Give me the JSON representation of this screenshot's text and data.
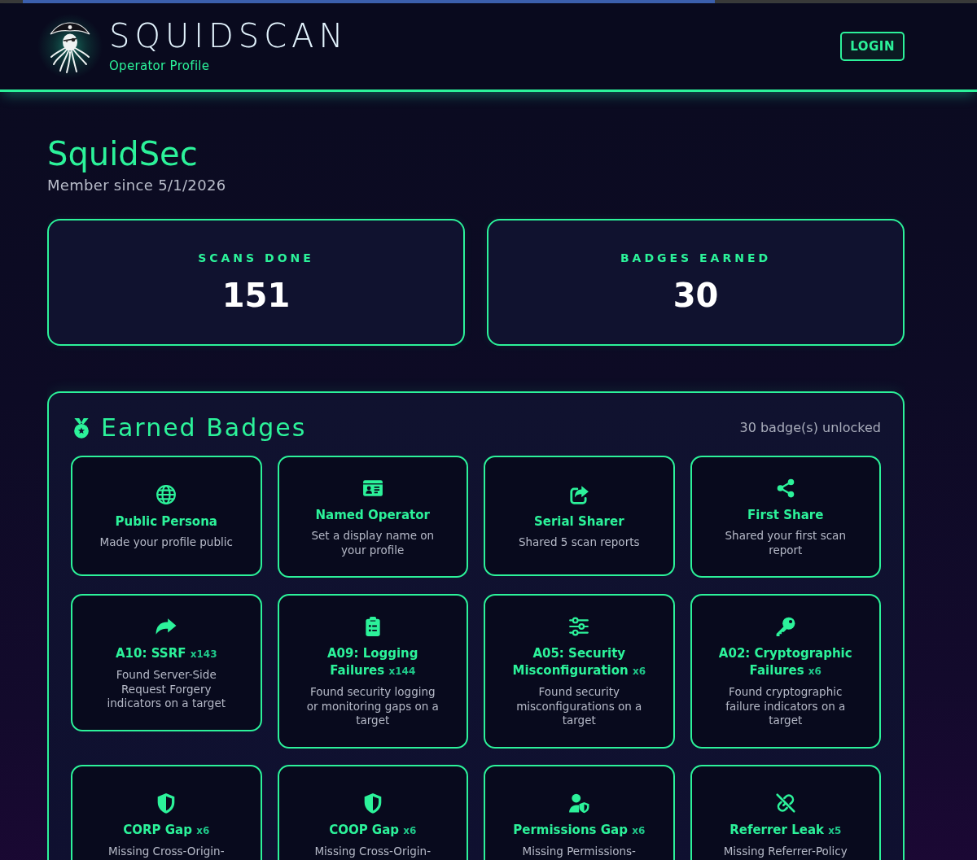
{
  "header": {
    "title": "SQUIDSCAN",
    "subtitle": "Operator Profile",
    "login_button": "LOGIN"
  },
  "profile": {
    "name": "SquidSec",
    "member_since": "Member since 5/1/2026"
  },
  "stats": [
    {
      "label": "SCANS DONE",
      "value": "151"
    },
    {
      "label": "BADGES EARNED",
      "value": "30"
    }
  ],
  "badges": {
    "title": "Earned Badges",
    "summary": "30 badge(s) unlocked",
    "items": [
      {
        "name": "Public Persona",
        "description": "Made your profile public"
      },
      {
        "name": "Named Operator",
        "description": "Set a display name on your profile"
      },
      {
        "name": "Serial Sharer",
        "description": "Shared 5 scan reports"
      },
      {
        "name": "First Share",
        "description": "Shared your first scan report"
      },
      {
        "name": "A10: SSRF",
        "count": "x143",
        "description": "Found Server-Side Request Forgery indicators on a target"
      },
      {
        "name": "A09: Logging Failures",
        "count": "x144",
        "description": "Found security logging or monitoring gaps on a target"
      },
      {
        "name": "A05: Security Misconfiguration",
        "count": "x6",
        "description": "Found security misconfigurations on a target"
      },
      {
        "name": "A02: Cryptographic Failures",
        "count": "x6",
        "description": "Found cryptographic failure indicators on a target"
      },
      {
        "name": "CORP Gap",
        "count": "x6",
        "description": "Missing Cross-Origin-"
      },
      {
        "name": "COOP Gap",
        "count": "x6",
        "description": "Missing Cross-Origin-"
      },
      {
        "name": "Permissions Gap",
        "count": "x6",
        "description": "Missing Permissions-"
      },
      {
        "name": "Referrer Leak",
        "count": "x5",
        "description": "Missing Referrer-Policy"
      }
    ]
  }
}
